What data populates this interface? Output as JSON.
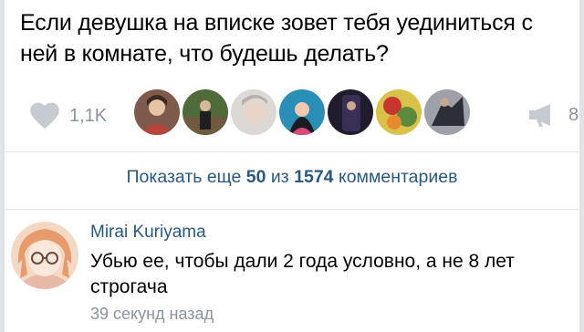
{
  "post": {
    "text": "Если девушка на вписке зовет тебя уединиться с ней в комнате, что будешь делать?"
  },
  "actions": {
    "like_icon": "heart-icon",
    "like_count": "1,1K",
    "share_icon": "megaphone-icon",
    "share_count": "8"
  },
  "likers": [
    {
      "name": "liker-avatar-1",
      "color": "#b5453a"
    },
    {
      "name": "liker-avatar-2",
      "color": "#3b5a2e"
    },
    {
      "name": "liker-avatar-3",
      "color": "#c9c4c0"
    },
    {
      "name": "liker-avatar-4",
      "color": "#2a8fb6"
    },
    {
      "name": "liker-avatar-5",
      "color": "#2d2a3d"
    },
    {
      "name": "liker-avatar-6",
      "color": "#c8342f"
    },
    {
      "name": "liker-avatar-7",
      "color": "#4a4e57"
    }
  ],
  "comments_bar": {
    "prefix": "Показать еще ",
    "shown": "50",
    "middle": " из ",
    "total": "1574",
    "suffix": " комментариев"
  },
  "comment": {
    "author": "Mirai Kuriyama",
    "text": "Убью ее, чтобы дали 2 года условно, а не 8 лет строгача",
    "time": "39 секунд назад"
  },
  "colors": {
    "link": "#2a5885",
    "muted": "#8a939e",
    "divider": "#e3e6ea"
  }
}
